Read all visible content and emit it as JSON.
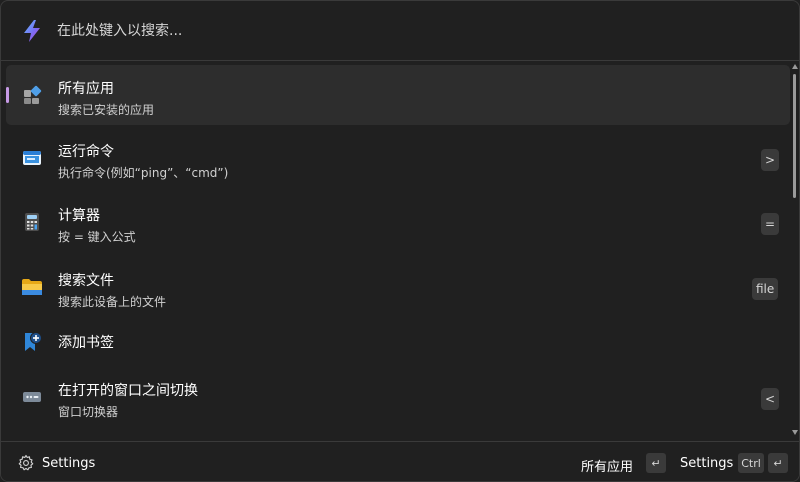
{
  "search": {
    "placeholder": "在此处键入以搜索..."
  },
  "items": [
    {
      "title": "所有应用",
      "subtitle": "搜索已安装的应用",
      "key": ""
    },
    {
      "title": "运行命令",
      "subtitle": "执行命令(例如“ping”、“cmd”)",
      "key": ">"
    },
    {
      "title": "计算器",
      "subtitle": "按 = 键入公式",
      "key": "="
    },
    {
      "title": "搜索文件",
      "subtitle": "搜索此设备上的文件",
      "key": "file"
    },
    {
      "title": "添加书签",
      "subtitle": "",
      "key": ""
    },
    {
      "title": "在打开的窗口之间切换",
      "subtitle": "窗口切换器",
      "key": "<"
    }
  ],
  "footer": {
    "settings_label": "Settings",
    "primary_action": "所有应用",
    "primary_key": "↵",
    "secondary_action": "Settings",
    "secondary_key_mod": "Ctrl",
    "secondary_key": "↵"
  },
  "colors": {
    "accent": "#c79ae6",
    "background": "#202020",
    "selected": "#2d2d2d"
  },
  "icons": {
    "search": "lightning-bolt-icon",
    "items": [
      "all-apps-icon",
      "run-command-icon",
      "calculator-icon",
      "folder-icon",
      "bookmark-add-icon",
      "window-switcher-icon"
    ],
    "footer": "gear-icon"
  }
}
